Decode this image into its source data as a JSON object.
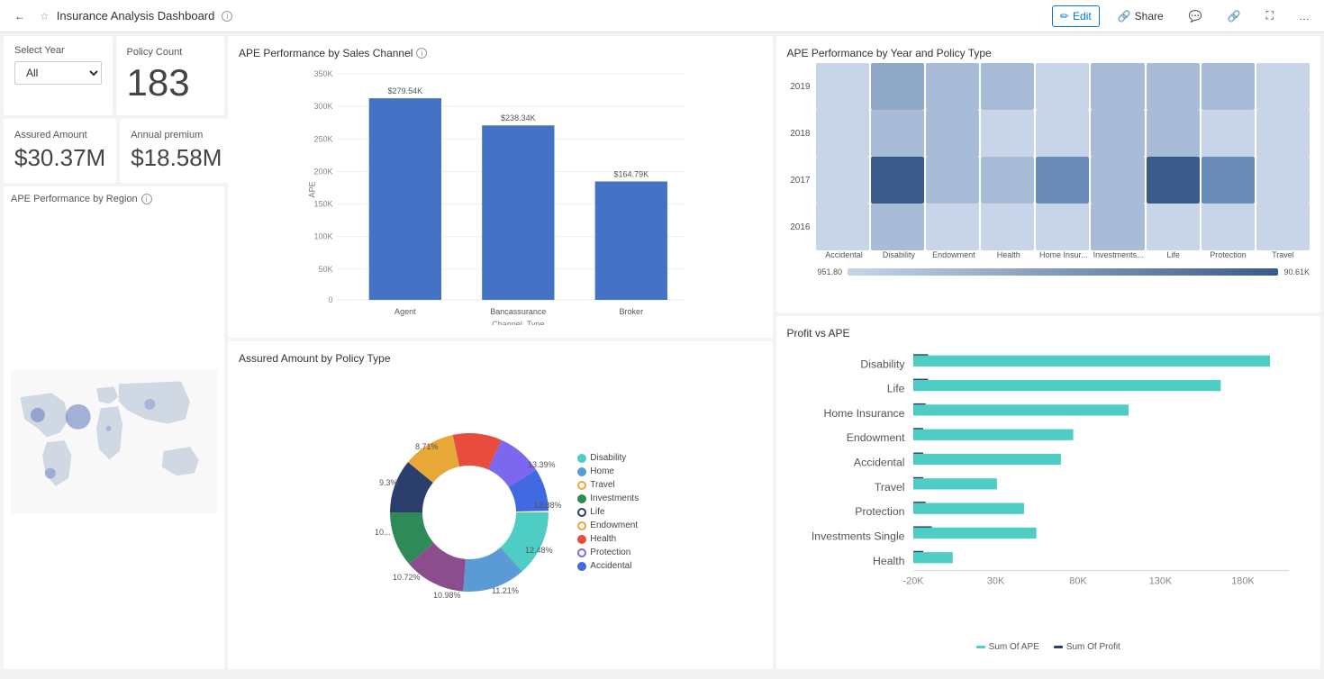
{
  "topbar": {
    "back_icon": "←",
    "title": "Insurance Analysis Dashboard",
    "info_icon": "ⓘ",
    "edit_label": "Edit",
    "share_label": "Share",
    "comment_icon": "💬",
    "bookmark_icon": "🔖",
    "expand_icon": "⛶",
    "more_icon": "..."
  },
  "filters": {
    "select_year_label": "Select Year",
    "select_year_value": "All"
  },
  "kpis": {
    "policy_count_label": "Policy Count",
    "policy_count_value": "183",
    "assured_label": "Assured Amount",
    "assured_value": "$30.37M",
    "annual_label": "Annual premium",
    "annual_value": "$18.58M"
  },
  "ape_by_channel": {
    "title": "APE Performance by Sales Channel",
    "x_label": "Channel_Type",
    "y_label": "APE",
    "bars": [
      {
        "label": "Agent",
        "value": 279540,
        "display": "$279.54K",
        "height_pct": 85
      },
      {
        "label": "Bancassurance",
        "value": 238340,
        "display": "$238.34K",
        "height_pct": 72
      },
      {
        "label": "Broker",
        "value": 164790,
        "display": "$164.79K",
        "height_pct": 50
      }
    ],
    "y_ticks": [
      "350K",
      "300K",
      "250K",
      "200K",
      "150K",
      "100K",
      "50K",
      "0"
    ]
  },
  "ape_by_year_type": {
    "title": "APE Performance by Year and Policy Type",
    "years": [
      "2019",
      "2018",
      "2017",
      "2016"
    ],
    "columns": [
      "Accidental",
      "Disability",
      "Endowment",
      "Health",
      "Home Insur...",
      "Investments...",
      "Life",
      "Protection",
      "Travel"
    ],
    "legend_min": "951.80",
    "legend_max": "90.61K",
    "heatmap": [
      [
        2,
        4,
        3,
        3,
        2,
        3,
        3,
        3,
        2
      ],
      [
        2,
        3,
        3,
        2,
        2,
        3,
        3,
        2,
        2
      ],
      [
        2,
        5,
        3,
        3,
        4,
        3,
        5,
        4,
        2
      ],
      [
        2,
        3,
        2,
        2,
        2,
        3,
        2,
        2,
        2
      ]
    ]
  },
  "assured_by_policy": {
    "title": "Assured Amount by Policy Type",
    "slices": [
      {
        "label": "Disability",
        "pct": 13.39,
        "color": "#4ECDC4",
        "border_color": "#4ECDC4"
      },
      {
        "label": "Home",
        "pct": 12.88,
        "color": "#5B9BD5",
        "border_color": "#5B9BD5"
      },
      {
        "label": "Travel",
        "pct": 12.48,
        "color": "#8B4D8B",
        "border_color": "#8B4D8B"
      },
      {
        "label": "Investments",
        "pct": 11.21,
        "color": "#2E8B57",
        "border_color": "#2E8B57"
      },
      {
        "label": "Life",
        "pct": 10.98,
        "color": "#2C3E6B",
        "border_color": "#2C3E6B"
      },
      {
        "label": "Endowment",
        "pct": 10.72,
        "color": "#E8A838",
        "border_color": "#E8A838"
      },
      {
        "label": "Health",
        "pct": 10.0,
        "color": "#E74C3C",
        "border_color": "#E74C3C"
      },
      {
        "label": "Protection",
        "pct": 9.3,
        "color": "#7B68EE",
        "border_color": "#7B68EE"
      },
      {
        "label": "Accidental",
        "pct": 8.71,
        "color": "#4169E1",
        "border_color": "#4169E1"
      }
    ],
    "labels_outside": [
      {
        "pos": "top-right",
        "text": "13.39%"
      },
      {
        "pos": "right",
        "text": "12.88%"
      },
      {
        "pos": "bottom-right",
        "text": "12.48%"
      },
      {
        "pos": "bottom",
        "text": "11.21%"
      },
      {
        "pos": "bottom-left",
        "text": "10.98%"
      },
      {
        "pos": "bottom-left2",
        "text": "10.72%"
      },
      {
        "pos": "left",
        "text": "10..."
      },
      {
        "pos": "top-left",
        "text": "9.3%"
      },
      {
        "pos": "top",
        "text": "8.71%"
      }
    ]
  },
  "profit_vs_ape": {
    "title": "Profit vs APE",
    "categories": [
      {
        "label": "Disability",
        "ape": 180,
        "profit": 12
      },
      {
        "label": "Life",
        "ape": 155,
        "profit": 12
      },
      {
        "label": "Home Insurance",
        "ape": 105,
        "profit": 10
      },
      {
        "label": "Endowment",
        "ape": 80,
        "profit": 8
      },
      {
        "label": "Accidental",
        "ape": 75,
        "profit": 8
      },
      {
        "label": "Travel",
        "ape": 40,
        "profit": 6
      },
      {
        "label": "Protection",
        "ape": 55,
        "profit": 8
      },
      {
        "label": "Investments Single",
        "ape": 60,
        "profit": 15
      },
      {
        "label": "Health",
        "ape": 20,
        "profit": 8
      }
    ],
    "x_ticks": [
      "-20K",
      "30K",
      "80K",
      "130K",
      "180K"
    ],
    "legend_ape": "Sum Of APE",
    "legend_profit": "Sum Of Profit",
    "ape_color": "#4ECDC4",
    "profit_color": "#2C3E6B"
  },
  "region_map": {
    "title": "APE Performance by Region"
  }
}
